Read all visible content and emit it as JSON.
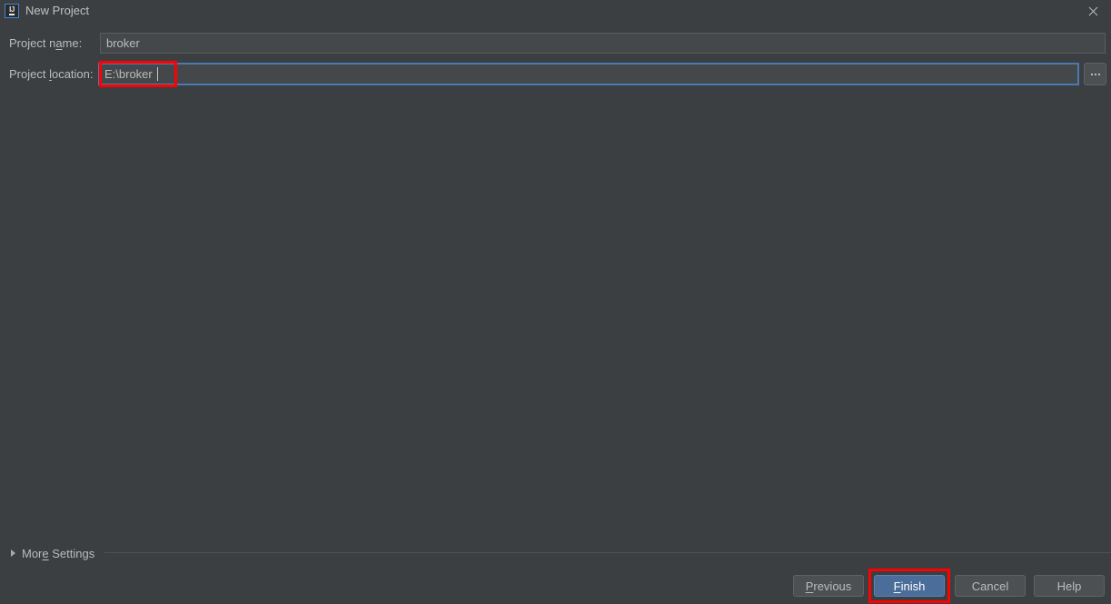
{
  "window": {
    "title": "New Project",
    "icon": "intellij-idea-icon",
    "close_icon": "close-icon",
    "background_color": "#3c3f41",
    "text_color": "#bbbbbb"
  },
  "form": {
    "project_name": {
      "label_prefix": "Project n",
      "label_mnemonic": "a",
      "label_suffix": "me:",
      "label_full": "Project name:",
      "value": "broker",
      "placeholder": ""
    },
    "project_location": {
      "label_prefix": "Project ",
      "label_mnemonic": "l",
      "label_suffix": "ocation:",
      "label_full": "Project location:",
      "value": "E:\\broker",
      "placeholder": "",
      "focused": true,
      "focus_color": "#4a7ab0"
    },
    "browse_button": {
      "label": "...",
      "icon": "ellipsis-icon"
    }
  },
  "more_settings": {
    "label_prefix": "Mor",
    "label_mnemonic": "e",
    "label_suffix": " Settings",
    "label_full": "More Settings",
    "expanded": false,
    "triangle_icon": "chevron-right-icon"
  },
  "footer": {
    "buttons": [
      {
        "id": "previous",
        "label_prefix": "",
        "label_mnemonic": "P",
        "label_suffix": "revious",
        "label_full": "Previous",
        "default": false
      },
      {
        "id": "finish",
        "label_prefix": "",
        "label_mnemonic": "F",
        "label_suffix": "inish",
        "label_full": "Finish",
        "default": true,
        "accent_color": "#4a6d99"
      },
      {
        "id": "cancel",
        "label_prefix": "Cancel",
        "label_mnemonic": "",
        "label_suffix": "",
        "label_full": "Cancel",
        "default": false
      },
      {
        "id": "help",
        "label_prefix": "Help",
        "label_mnemonic": "",
        "label_suffix": "",
        "label_full": "Help",
        "default": false
      }
    ]
  },
  "annotations": {
    "color": "#fe0000",
    "highlight_location_field": true,
    "highlight_finish_button": true
  }
}
